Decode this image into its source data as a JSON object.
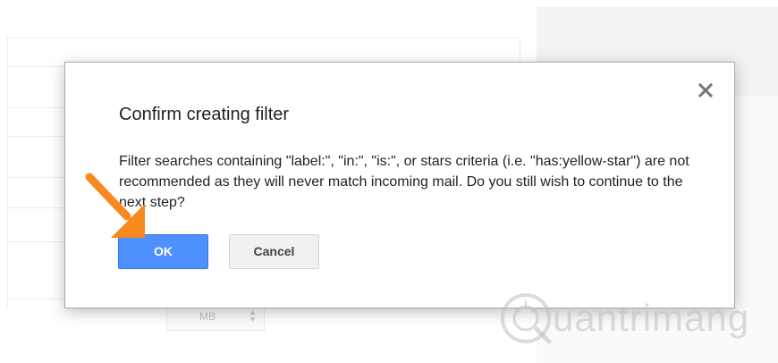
{
  "background": {
    "size_unit": "MB",
    "spinner_up": "▲",
    "spinner_down": "▼"
  },
  "dialog": {
    "title": "Confirm creating filter",
    "close_icon": "close-icon",
    "message": "Filter searches containing \"label:\", \"in:\", \"is:\", or stars criteria (i.e. \"has:yellow-star\") are not recommended as they will never match incoming mail. Do you still wish to continue to the next step?",
    "ok_label": "OK",
    "cancel_label": "Cancel"
  },
  "watermark": {
    "text": "uantrimang",
    "logo_icon": "quantrimang-logo"
  },
  "colors": {
    "ok_button": "#4d90fe",
    "cancel_button": "#f1f1f1",
    "arrow": "#f7891f"
  }
}
